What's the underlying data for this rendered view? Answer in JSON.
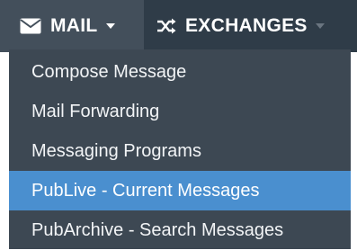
{
  "navbar": {
    "mail": {
      "label": "MAIL",
      "icon": "envelope-icon"
    },
    "exchanges": {
      "label": "EXCHANGES",
      "icon": "shuffle-icon"
    }
  },
  "dropdown": {
    "items": [
      {
        "label": "Compose Message"
      },
      {
        "label": "Mail Forwarding"
      },
      {
        "label": "Messaging Programs"
      },
      {
        "label": "PubLive - Current Messages",
        "active": true
      },
      {
        "label": "PubArchive - Search Messages"
      }
    ]
  },
  "colors": {
    "navbar_bg": "#2f3c48",
    "mail_tab_bg": "#434f5b",
    "dropdown_bg": "#3d4853",
    "active_item_bg": "#4a8fcf"
  }
}
